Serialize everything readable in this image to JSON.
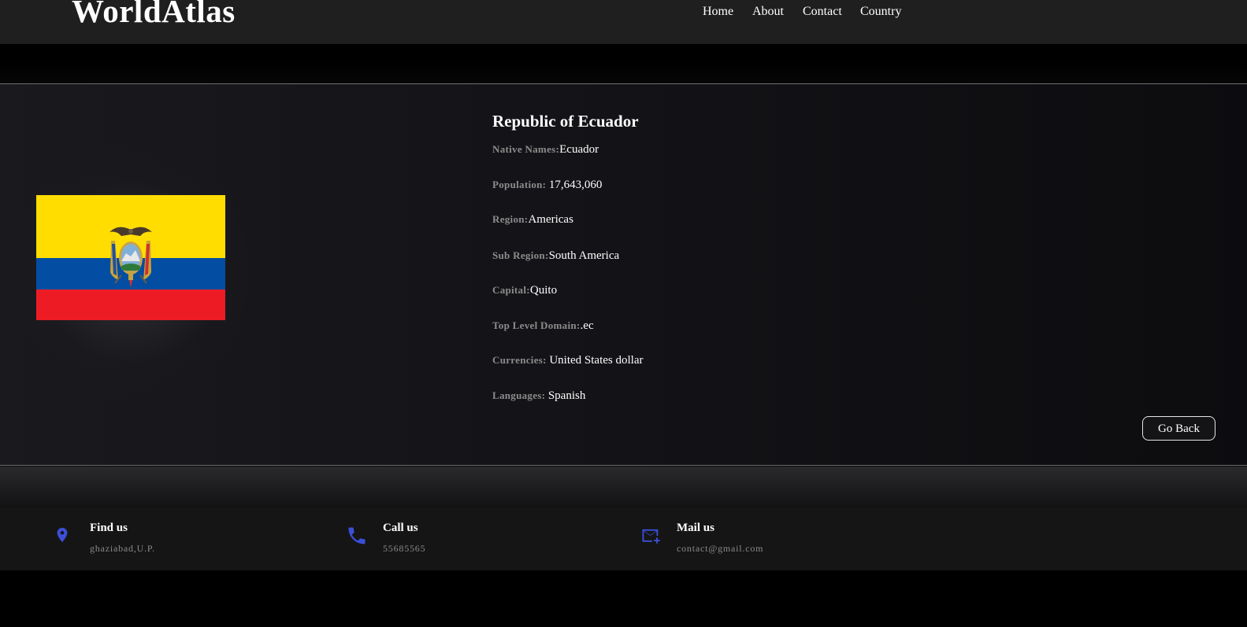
{
  "header": {
    "logo": "WorldAtlas",
    "nav": [
      "Home",
      "About",
      "Contact",
      "Country"
    ]
  },
  "country": {
    "title": "Republic of Ecuador",
    "flag_icon": "ecuador-flag",
    "details": [
      {
        "label": "Native Names:",
        "value": "Ecuador"
      },
      {
        "label": "Population: ",
        "value": "17,643,060"
      },
      {
        "label": "Region:",
        "value": "Americas"
      },
      {
        "label": "Sub Region:",
        "value": "South America"
      },
      {
        "label": "Capital:",
        "value": "Quito"
      },
      {
        "label": "Top Level Domain:",
        "value": ".ec"
      },
      {
        "label": "Currencies: ",
        "value": "United States dollar"
      },
      {
        "label": "Languages: ",
        "value": "Spanish"
      }
    ],
    "go_back_label": "Go Back"
  },
  "footer": {
    "items": [
      {
        "icon": "location-pin-icon",
        "title": "Find us",
        "subtitle": "ghaziabad,U.P."
      },
      {
        "icon": "phone-icon",
        "title": "Call us",
        "subtitle": "55685565"
      },
      {
        "icon": "mail-icon",
        "title": "Mail us",
        "subtitle": "contact@gmail.com"
      }
    ],
    "icon_color": "#3b4fd8"
  }
}
